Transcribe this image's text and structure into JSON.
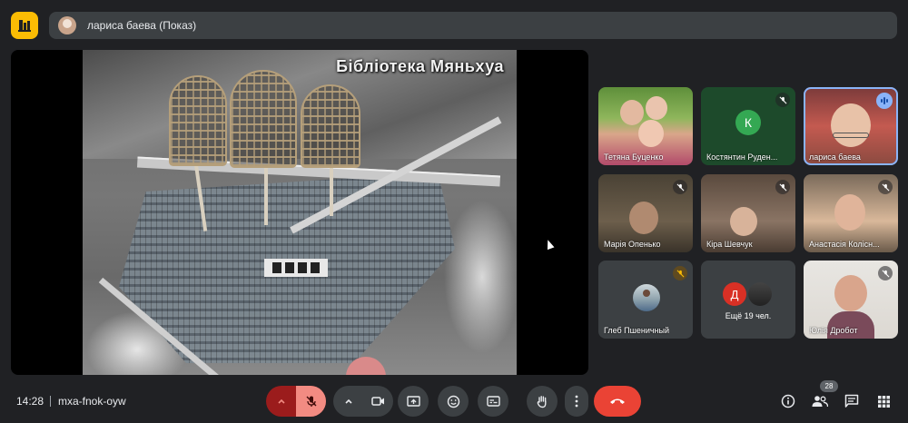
{
  "presenter_bar": {
    "label": "лариса баева (Показ)"
  },
  "presentation": {
    "slide_title": "Бібліотека Мяньхуа"
  },
  "participants": [
    {
      "name": "Тетяна Буценко",
      "muted": false
    },
    {
      "name": "Костянтин Руден...",
      "muted": true,
      "avatar_letter": "К",
      "avatar_color": "#34a853"
    },
    {
      "name": "лариса баева",
      "speaking": true
    },
    {
      "name": "Марія Опенько",
      "muted": true
    },
    {
      "name": "Кіра Шевчук",
      "muted": true
    },
    {
      "name": "Анастасія Колісн...",
      "muted": true
    },
    {
      "name": "Глеб Пшеничный",
      "muted": true
    },
    {
      "more_label": "Ещё 19 чел.",
      "avatar_letter": "Д",
      "avatar_color": "#d93025"
    },
    {
      "name": "Юлія Дробот",
      "muted": true
    }
  ],
  "bottom_bar": {
    "time": "14:28",
    "meeting_code": "mxa-fnok-oyw",
    "people_count": "28"
  },
  "colors": {
    "leave": "#ea4335",
    "accent": "#8ab4f8",
    "logo": "#fbbc04"
  },
  "icons": [
    "mic-off-icon",
    "camera-icon",
    "present-icon",
    "emoji-icon",
    "captions-icon",
    "raise-hand-icon",
    "more-icon",
    "end-call-icon",
    "info-icon",
    "people-icon",
    "chat-icon",
    "activities-icon"
  ]
}
